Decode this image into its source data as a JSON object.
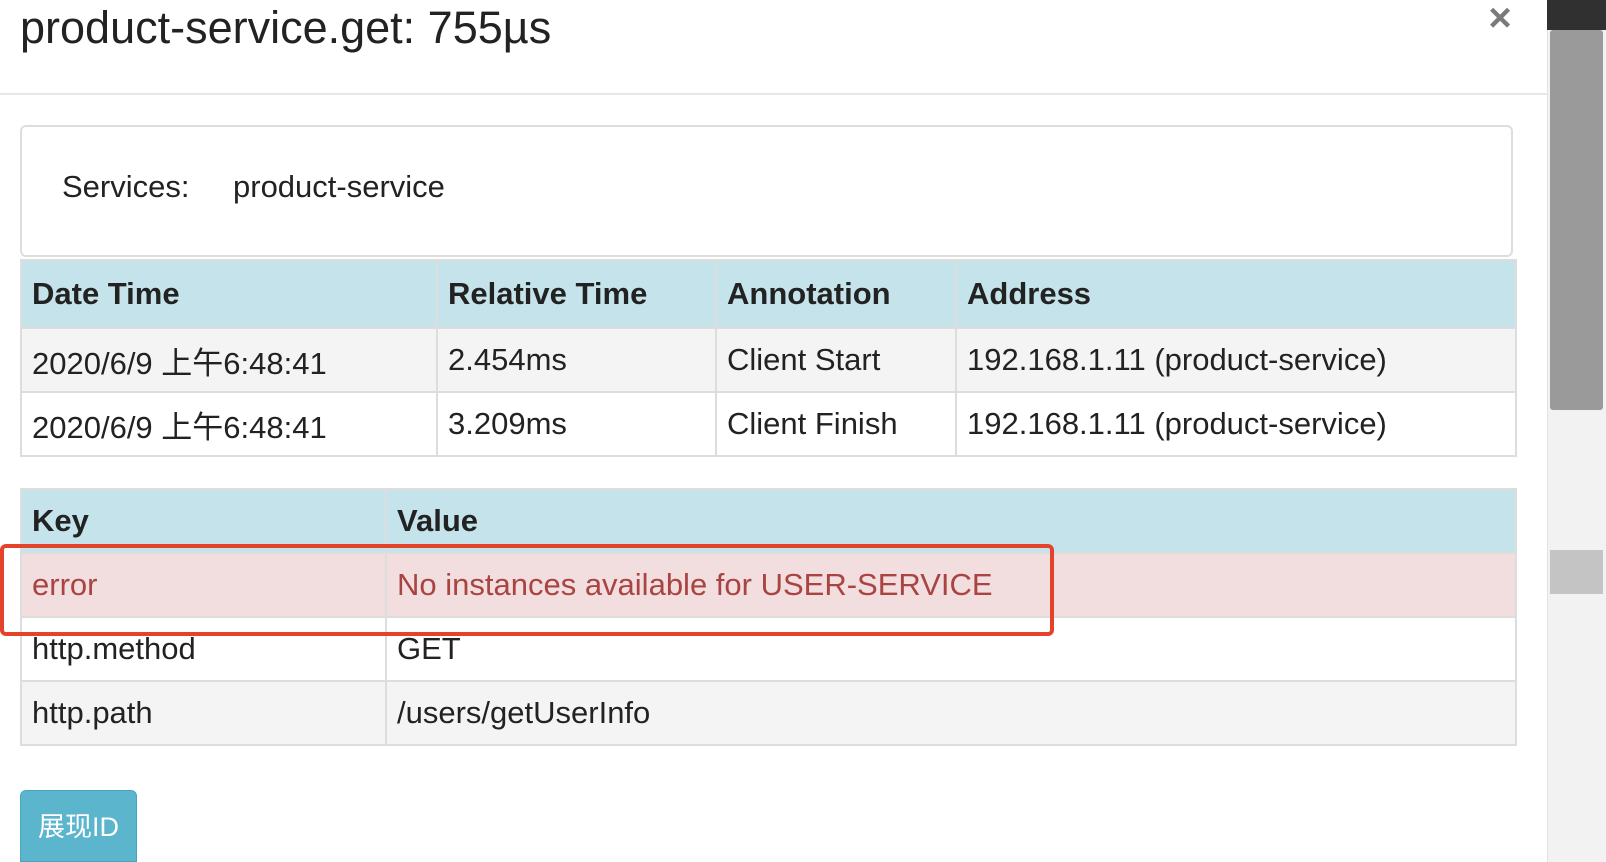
{
  "modal": {
    "title": "product-service.get: 755µs",
    "close_label": "×"
  },
  "services": {
    "label": "Services:",
    "value": "product-service"
  },
  "annotations": {
    "headers": [
      "Date Time",
      "Relative Time",
      "Annotation",
      "Address"
    ],
    "rows": [
      [
        "2020/6/9 上午6:48:41",
        "2.454ms",
        "Client Start",
        "192.168.1.11 (product-service)"
      ],
      [
        "2020/6/9 上午6:48:41",
        "3.209ms",
        "Client Finish",
        "192.168.1.11 (product-service)"
      ]
    ]
  },
  "tags": {
    "headers": [
      "Key",
      "Value"
    ],
    "rows": [
      [
        "error",
        "No instances available for USER-SERVICE"
      ],
      [
        "http.method",
        "GET"
      ],
      [
        "http.path",
        "/users/getUserInfo"
      ]
    ]
  },
  "buttons": {
    "show_id": "展现ID"
  },
  "colors": {
    "header_bg": "#c5e3ea",
    "error_bg": "#f2dede",
    "error_text": "#a94442",
    "highlight_border": "#e2432a",
    "button_bg": "#5bb5cd"
  }
}
